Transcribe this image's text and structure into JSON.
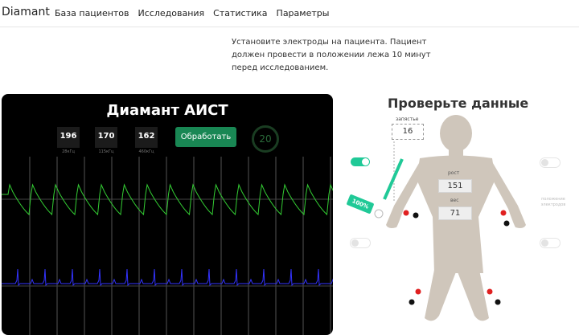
{
  "nav": {
    "brand": "Diamant",
    "links": [
      "База пациентов",
      "Исследования",
      "Статистика",
      "Параметры"
    ]
  },
  "instruction": "Установите электроды на пациента. Пациент должен провести в положении лежа 10 минут перед исследованием.",
  "monitor": {
    "title": "Диамант АИСТ",
    "freqs": [
      {
        "value": "196",
        "unit": "28кГц"
      },
      {
        "value": "170",
        "unit": "115кГц"
      },
      {
        "value": "162",
        "unit": "460кГц"
      }
    ],
    "process_label": "Обработать",
    "timer": "20",
    "colors": {
      "upper_wave": "#33cc33",
      "lower_wave": "#3333ff"
    }
  },
  "check": {
    "title": "Проверьте данные",
    "wrist_label": "запястье",
    "wrist_value": "16",
    "height_label": "рост",
    "height_value": "151",
    "weight_label": "вес",
    "weight_value": "71",
    "percent": "100%",
    "side_label": "положение электродов"
  }
}
